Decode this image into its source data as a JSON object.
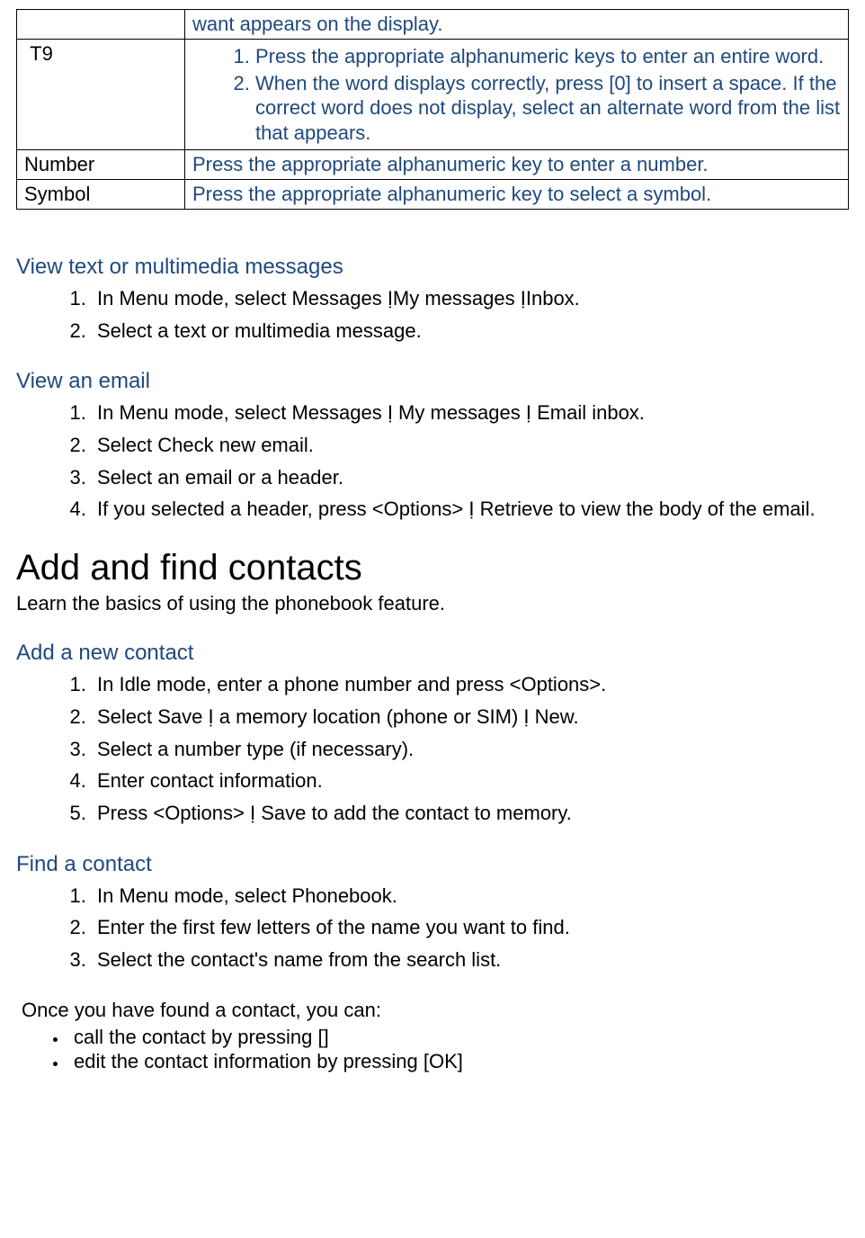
{
  "table": {
    "row0_right": "want appears on the display.",
    "row1_left": "T9",
    "row1_step1": "Press the appropriate alphanumeric keys to enter an entire word.",
    "row1_step2": "When the word displays correctly, press [0] to insert a space. If the correct word does not display, select an alternate word from the list that appears.",
    "row2_left": "Number",
    "row2_right": "Press the appropriate alphanumeric key to enter a number.",
    "row3_left": "Symbol",
    "row3_right": "Press the appropriate alphanumeric key to select a symbol."
  },
  "section1": {
    "title": "View text or multimedia messages",
    "step1": "In Menu mode, select Messages ỊMy messages ỊInbox.",
    "step2": "Select a text or multimedia message."
  },
  "section2": {
    "title": "View an email",
    "step1": "In Menu mode, select Messages Ị My messages Ị Email inbox.",
    "step2": "Select Check new email.",
    "step3": "Select an email or a header.",
    "step4": "If you selected a header, press <Options> Ị Retrieve to view the body of the email."
  },
  "big_heading": "Add and find contacts",
  "big_intro": "Learn the basics of using the phonebook feature.",
  "section3": {
    "title": "Add a new contact",
    "step1": "In Idle mode, enter a phone number and press <Options>.",
    "step2": "Select Save Ị a memory location (phone or SIM) Ị New.",
    "step3": "Select a number type (if necessary).",
    "step4": "Enter contact information.",
    "step5": "Press <Options> Ị Save to add the contact to memory."
  },
  "section4": {
    "title": "Find a contact",
    "step1": "In Menu mode, select Phonebook.",
    "step2": "Enter the first few letters of the name you want to find.",
    "step3": "Select the contact's name from the search list."
  },
  "once_found": {
    "intro": "Once you have found a contact, you can:",
    "bullet1": "call the contact by pressing []",
    "bullet2": "edit the contact information by pressing [OK]"
  }
}
